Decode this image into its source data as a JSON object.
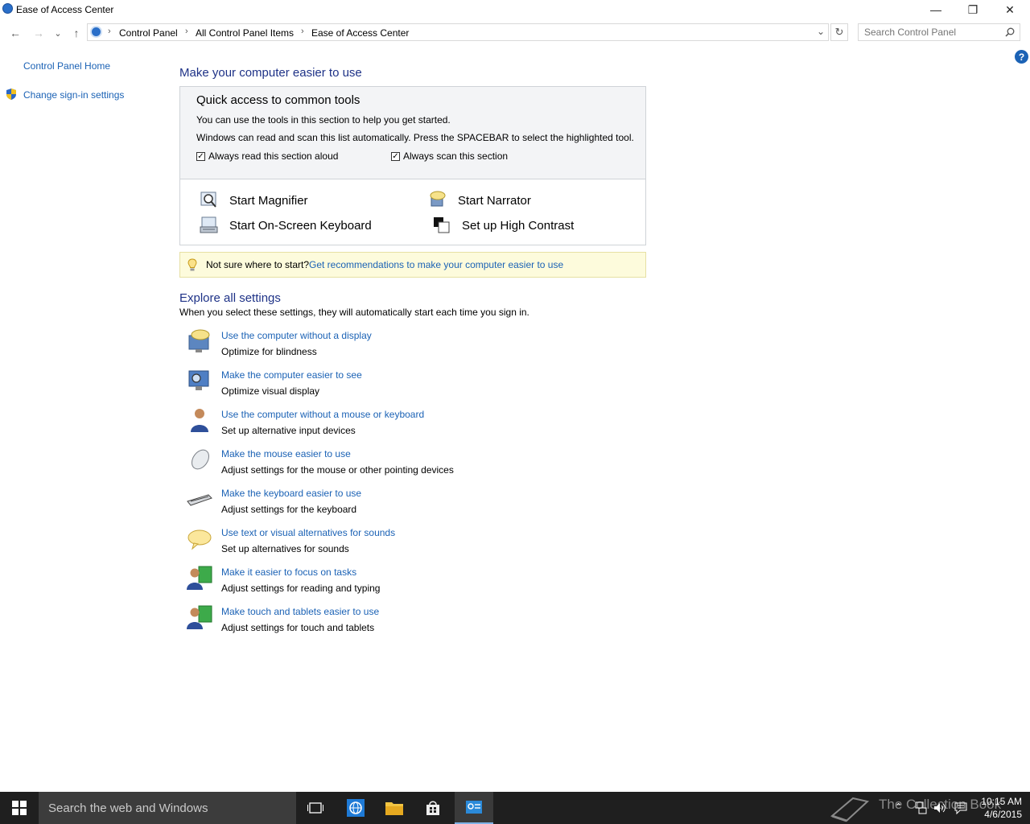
{
  "window": {
    "title": "Ease of Access Center",
    "minimize": "—",
    "restore": "❐",
    "close": "✕"
  },
  "nav": {
    "back": "←",
    "forward": "→",
    "recent": "⌄",
    "up": "↑",
    "breadcrumb": [
      "Control Panel",
      "All Control Panel Items",
      "Ease of Access Center"
    ],
    "breadcrumb_sep": "›",
    "dropdown": "⌄",
    "refresh": "↻",
    "search_placeholder": "Search Control Panel"
  },
  "sidebar": {
    "items": [
      {
        "label": "Control Panel Home"
      },
      {
        "label": "Change sign-in settings"
      }
    ]
  },
  "help": "?",
  "main": {
    "heading": "Make your computer easier to use",
    "quick": {
      "title": "Quick access to common tools",
      "line1": "You can use the tools in this section to help you get started.",
      "line2": "Windows can read and scan this list automatically.  Press the SPACEBAR to select the highlighted tool.",
      "check_read": {
        "label": "Always read this section aloud",
        "checked": true
      },
      "check_scan": {
        "label": "Always scan this section",
        "checked": true
      },
      "tools": [
        "Start Magnifier",
        "Start Narrator",
        "Start On-Screen Keyboard",
        "Set up High Contrast"
      ]
    },
    "tip": {
      "prefix": "Not sure where to start?",
      "link": "Get recommendations to make your computer easier to use"
    },
    "explore": {
      "heading": "Explore all settings",
      "sub": "When you select these settings, they will automatically start each time you sign in.",
      "items": [
        {
          "link": "Use the computer without a display",
          "desc": "Optimize for blindness"
        },
        {
          "link": "Make the computer easier to see",
          "desc": "Optimize visual display"
        },
        {
          "link": "Use the computer without a mouse or keyboard",
          "desc": "Set up alternative input devices"
        },
        {
          "link": "Make the mouse easier to use",
          "desc": "Adjust settings for the mouse or other pointing devices"
        },
        {
          "link": "Make the keyboard easier to use",
          "desc": "Adjust settings for the keyboard"
        },
        {
          "link": "Use text or visual alternatives for sounds",
          "desc": "Set up alternatives for sounds"
        },
        {
          "link": "Make it easier to focus on tasks",
          "desc": "Adjust settings for reading and typing"
        },
        {
          "link": "Make touch and tablets easier to use",
          "desc": "Adjust settings for touch and tablets"
        }
      ]
    }
  },
  "taskbar": {
    "search_placeholder": "Search the web and Windows",
    "watermark": "The Collection Book",
    "time": "10:15 AM",
    "date": "4/6/2015"
  },
  "colors": {
    "link": "#1b62b5",
    "heading": "#1e3287",
    "accent": "#0078d7",
    "taskbar": "#1f1f1f"
  }
}
